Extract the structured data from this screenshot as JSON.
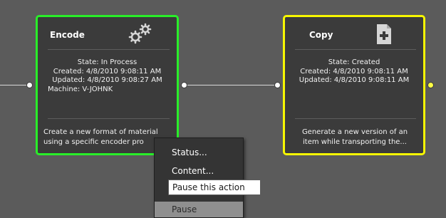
{
  "nodes": {
    "encode": {
      "title": "Encode",
      "state": "State: In Process",
      "created": "Created: 4/8/2010 9:08:11 AM",
      "updated": "Updated: 4/8/2010 9:08:27 AM",
      "machine": "Machine: V-JOHNK",
      "description_line1": "Create a new format of material",
      "description_line2": "using a specific encoder pro",
      "icon": "gears-icon",
      "border_color": "#29ee29"
    },
    "copy": {
      "title": "Copy",
      "state": "State: Created",
      "created": "Created: 4/8/2010 9:08:11 AM",
      "updated": "Updated: 4/8/2010 9:08:11 AM",
      "description_line1": "Generate a new version of an",
      "description_line2": "item while transporting the...",
      "icon": "document-add-icon",
      "border_color": "#f7f700"
    }
  },
  "context_menu": {
    "items": [
      {
        "label": "Status..."
      },
      {
        "label": "Content..."
      },
      {
        "label": ""
      },
      {
        "label": "Pause",
        "disabled": true
      }
    ]
  },
  "tooltip": {
    "text": "Pause this action"
  },
  "colors": {
    "canvas": "#5b5b5b",
    "node_bg": "#3b3b3b",
    "connector": "#d8d8d8",
    "port_active": "#ffff44"
  }
}
